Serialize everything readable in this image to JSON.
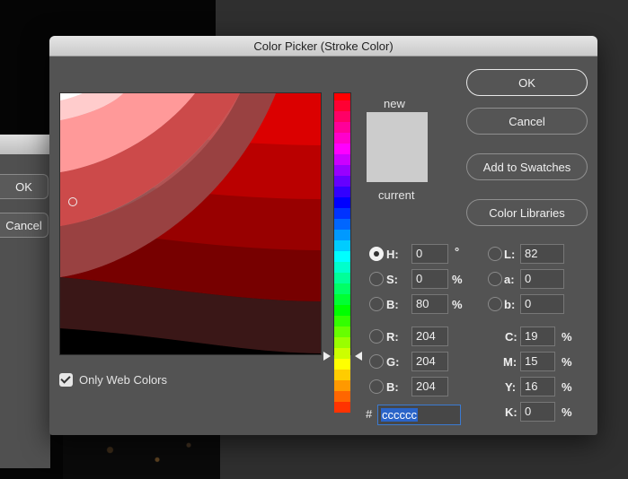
{
  "background_dialog": {
    "ok_label": "OK",
    "cancel_label": "Cancel"
  },
  "dialog": {
    "title": "Color Picker (Stroke Color)",
    "new_label": "new",
    "current_label": "current",
    "new_color": "#cccccc",
    "current_color": "#cccccc",
    "only_web_colors_label": "Only Web Colors",
    "only_web_colors_checked": true,
    "buttons": {
      "ok": "OK",
      "cancel": "Cancel",
      "add_to_swatches": "Add to Swatches",
      "color_libraries": "Color Libraries"
    },
    "fields": {
      "h": {
        "label": "H:",
        "value": "0",
        "unit": "°",
        "selected": true
      },
      "s": {
        "label": "S:",
        "value": "0",
        "unit": "%"
      },
      "b": {
        "label": "B:",
        "value": "80",
        "unit": "%"
      },
      "r": {
        "label": "R:",
        "value": "204"
      },
      "g": {
        "label": "G:",
        "value": "204"
      },
      "bl": {
        "label": "B:",
        "value": "204"
      },
      "l": {
        "label": "L:",
        "value": "82"
      },
      "a": {
        "label": "a:",
        "value": "0"
      },
      "lab_b": {
        "label": "b:",
        "value": "0"
      },
      "c": {
        "label": "C:",
        "value": "19",
        "unit": "%"
      },
      "m": {
        "label": "M:",
        "value": "15",
        "unit": "%"
      },
      "y": {
        "label": "Y:",
        "value": "16",
        "unit": "%"
      },
      "k": {
        "label": "K:",
        "value": "0",
        "unit": "%"
      }
    },
    "hex_label": "#",
    "hex_value": "cccccc"
  }
}
